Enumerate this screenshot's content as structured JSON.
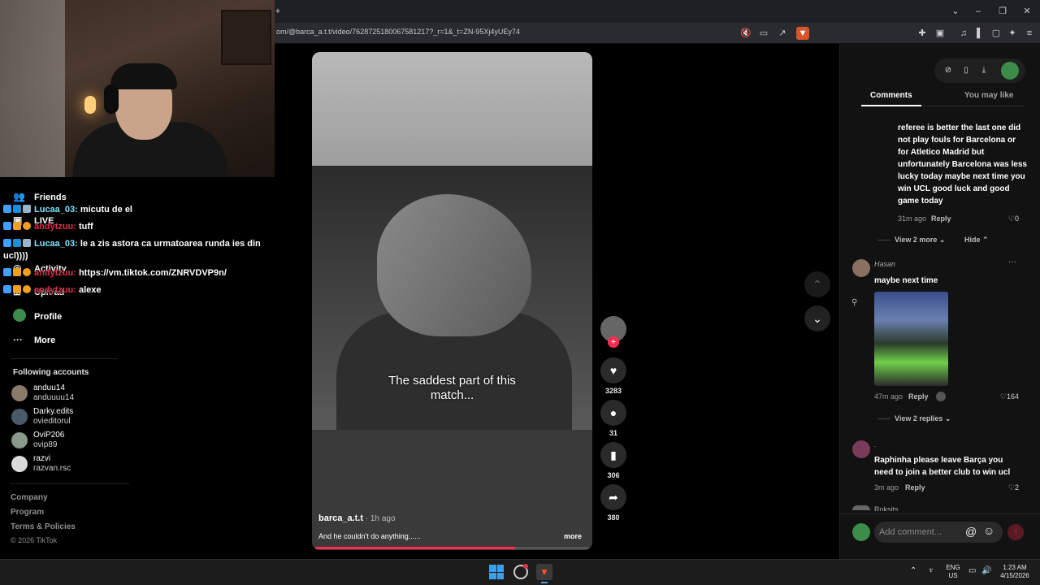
{
  "browser": {
    "url": "om/@barca_a.t.t/video/7628725180067581217?_r=1&_t=ZN-95Xj4yUEy74",
    "new_tab": "+"
  },
  "chat": [
    {
      "user": "Lucaa_03:",
      "message": "micutu de el",
      "user_color": "#7fe3ff"
    },
    {
      "user": "andytzuu:",
      "message": "tuff",
      "user_color": "#e0304a"
    },
    {
      "user": "Lucaa_03:",
      "message": "le a zis astora ca urmatoarea runda ies din",
      "user_color": "#7fe3ff"
    },
    {
      "continuation": "ucl))))"
    },
    {
      "user": "andytzuu:",
      "message": "https://vm.tiktok.com/ZNRVDVP9n/",
      "user_color": "#e0304a"
    },
    {
      "user": "andytzuu:",
      "message": "alexe",
      "user_color": "#e0304a"
    }
  ],
  "sidebar": {
    "nav": [
      {
        "label": "Friends",
        "icon": "friends-icon"
      },
      {
        "label": "LIVE",
        "icon": "live-icon"
      },
      {
        "label": "Activity",
        "icon": "activity-icon"
      },
      {
        "label": "Upload",
        "icon": "upload-icon"
      },
      {
        "label": "Profile",
        "icon": "profile-avatar"
      },
      {
        "label": "More",
        "icon": "more-icon"
      }
    ],
    "following_title": "Following accounts",
    "accounts": [
      {
        "name": "anduu14",
        "handle": "anduuuu14",
        "color": "#8a7a6a"
      },
      {
        "name": "Darky.edits",
        "handle": "ovieditorul",
        "color": "#4a5a6a"
      },
      {
        "name": "OviP206",
        "handle": "ovip89",
        "color": "#8a9a8a"
      },
      {
        "name": "razvi",
        "handle": "razvan.rsc",
        "color": "#dcdcdc"
      }
    ],
    "footer": [
      "Company",
      "Program",
      "Terms & Policies"
    ],
    "copyright": "© 2026 TikTok"
  },
  "video": {
    "caption_line1": "The saddest part of this",
    "caption_line2": "match...",
    "author": "barca_a.t.t",
    "time_ago": " · 1h ago",
    "description": "And he couldn't do anything......",
    "more": "more",
    "progress": 0.73
  },
  "actions": {
    "likes": "3283",
    "comments": "31",
    "saves": "306",
    "shares": "380"
  },
  "comments_panel": {
    "tab_comments": "Comments",
    "tab_you_may_like": "You may like",
    "c1": {
      "text": "referee is better the last one did not play fouls for Barcelona or for Atletico Madrid but unfortunately Barcelona was less lucky today maybe next time you win UCL good luck and good game today",
      "time": "31m ago",
      "reply": "Reply",
      "likes": "0",
      "view_more": "View 2 more",
      "hide": "Hide"
    },
    "c2": {
      "name": "Hasan",
      "text": "maybe next time",
      "time": "47m ago",
      "reply": "Reply",
      "likes": "164",
      "view_replies": "View 2 replies"
    },
    "c3": {
      "name": ".",
      "text": "Raphinha please leave Barça you need to join a better club to win ucl",
      "time": "3m ago",
      "reply": "Reply",
      "likes": "2"
    },
    "c4_name": "Roksits",
    "input_placeholder": "Add comment..."
  },
  "taskbar": {
    "lang1": "ENG",
    "lang2": "US",
    "time": "1:23 AM",
    "date": "4/15/2026"
  }
}
